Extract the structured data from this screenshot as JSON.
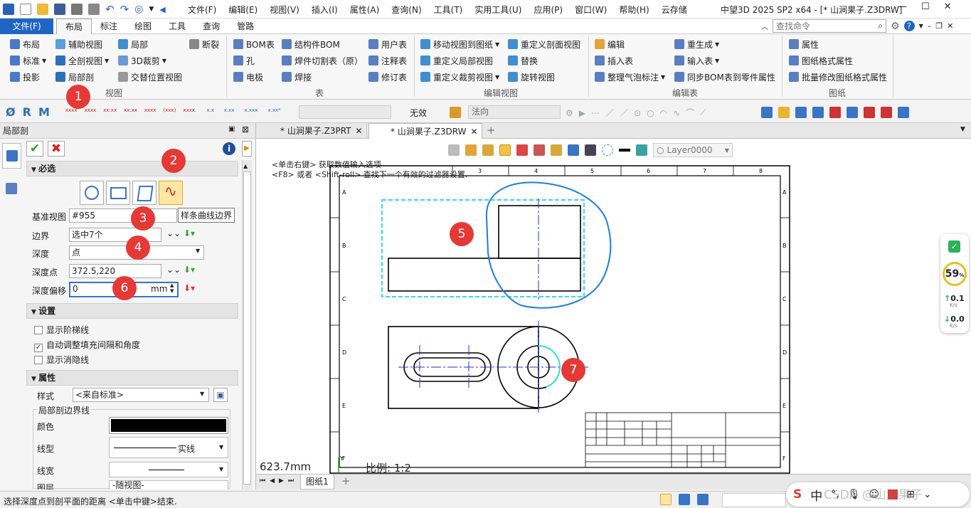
{
  "app": {
    "title": "中望3D 2025 SP2 x64 - [* 山涧果子.Z3DRW]",
    "menu": [
      "文件(F)",
      "编辑(E)",
      "视图(V)",
      "插入(I)",
      "属性(A)",
      "查询(N)",
      "工具(T)",
      "实用工具(U)",
      "应用(P)",
      "窗口(W)",
      "帮助(H)",
      "云存储"
    ]
  },
  "ribbon": {
    "tabs": [
      "文件(F)",
      "布局",
      "标注",
      "绘图",
      "工具",
      "查询",
      "管路"
    ],
    "search_placeholder": "查找命令",
    "view": {
      "items": [
        "布局",
        "辅助视图",
        "局部",
        "断裂",
        "标准",
        "全剖视图",
        "3D裁剪",
        "投影",
        "局部剖",
        "交替位置视图"
      ],
      "label": "视图"
    },
    "table": {
      "items": [
        "BOM表",
        "结构件BOM",
        "用户表",
        "孔",
        "焊件切割表（原）",
        "注释表",
        "电极",
        "焊接",
        "修订表"
      ],
      "label": "表"
    },
    "edit_view": {
      "items": [
        "移动视图到图纸",
        "重定义剖面视图",
        "重定义局部视图",
        "替换",
        "重定义裁剪视图",
        "旋转视图"
      ],
      "label": "编辑视图"
    },
    "edit_table": {
      "items": [
        "编辑",
        "重生成",
        "插入表",
        "输入表",
        "整理气泡标注",
        "同步BOM表到零件属性"
      ],
      "label": "编辑表"
    },
    "sheet": {
      "items": [
        "属性",
        "图纸格式属性",
        "批量修改图纸格式属性"
      ],
      "label": "图纸"
    }
  },
  "quick": {
    "filter_value": "无效",
    "normal_value": "法向",
    "letters": [
      "Ø",
      "R",
      "M"
    ]
  },
  "panel": {
    "title": "局部剖",
    "required_label": "必选",
    "tooltip": "样条曲线边界",
    "fields": {
      "base_view_label": "基准视图",
      "base_view_value": "#955",
      "boundary_label": "边界",
      "boundary_value": "选中7个",
      "depth_label": "深度",
      "depth_value": "点",
      "depth_point_label": "深度点",
      "depth_point_value": "372.5,220",
      "depth_offset_label": "深度偏移",
      "depth_offset_value": "0",
      "depth_offset_unit": "mm"
    },
    "settings_label": "设置",
    "settings": [
      "显示阶梯线",
      "自动调整填充间隔和角度",
      "显示消隐线"
    ],
    "settings_checked": [
      false,
      true,
      false
    ],
    "props_label": "属性",
    "style_label": "样式",
    "style_value": "<来自标准>",
    "boundary_group": "局部剖边界线",
    "color_label": "颜色",
    "linetype_label": "线型",
    "linetype_value": "实线",
    "linewidth_label": "线宽",
    "layer_label": "图层",
    "layer_value": "-随视图-"
  },
  "doc_tabs": [
    "* 山涧果子.Z3PRT",
    "* 山涧果子.Z3DRW"
  ],
  "canvas": {
    "prompt1": "<单击右键> 获取数值输入选项",
    "prompt2": "<F8> 或者 <Shift-roll> 查找下一个有效的过滤器设置.",
    "layer": "Layer0000",
    "dim": "623.7mm",
    "scale": "比例:   1:2",
    "cols": [
      "3",
      "4",
      "5",
      "6",
      "7",
      "8"
    ],
    "rows": [
      "A",
      "B",
      "C",
      "D",
      "E",
      "F"
    ]
  },
  "badges": [
    "1",
    "2",
    "3",
    "4",
    "5",
    "6",
    "7"
  ],
  "monitor": {
    "percent": "59",
    "up": "0.1",
    "down": "0.0",
    "unit": "K/s"
  },
  "sheet_tab": "图纸1",
  "status_text": "选择深度点到剖平面的距离 <单击中键>结束.",
  "tray": {
    "ime": "中",
    "wm": "CSDN @山涧果子"
  },
  "colors": {
    "accent": "#1f66c3",
    "badge": "#e53935",
    "spline": "#1a7fe0",
    "cyan": "#33ddee",
    "center": "#2233cc"
  }
}
